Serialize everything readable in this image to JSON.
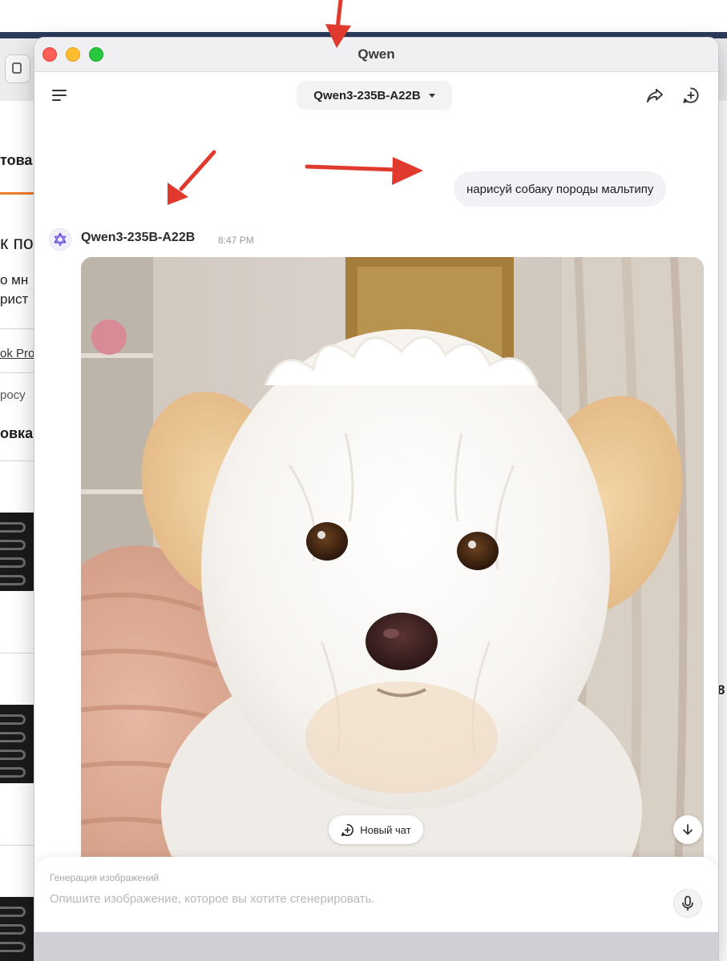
{
  "window": {
    "title": "Qwen"
  },
  "header": {
    "model_selector": "Qwen3-235B-A22B",
    "icons": {
      "menu": "hamburger-menu-icon",
      "share": "share-icon",
      "new_chat": "new-chat-icon"
    }
  },
  "chat": {
    "user_message": "нарисуй собаку породы мальтипу",
    "bot": {
      "name": "Qwen3-235B-A22B",
      "time": "8:47 PM"
    }
  },
  "floating": {
    "new_chat_label": "Новый чат"
  },
  "composer": {
    "mode_label": "Генерация изображений",
    "placeholder": "Опишите изображение, которое вы хотите сгенерировать.",
    "mic_icon": "microphone-icon"
  },
  "background_app": {
    "fragments": [
      "това",
      "к по",
      "о мн",
      "рист",
      "ok Pro",
      "росу",
      "овка:"
    ],
    "right_marks": [
      "8"
    ]
  },
  "colors": {
    "annotation_arrow": "#e03a2e",
    "accent_tab": "#f07b2a",
    "traffic_close": "#fe5f57",
    "traffic_min": "#febc2e",
    "traffic_max": "#28c840"
  }
}
